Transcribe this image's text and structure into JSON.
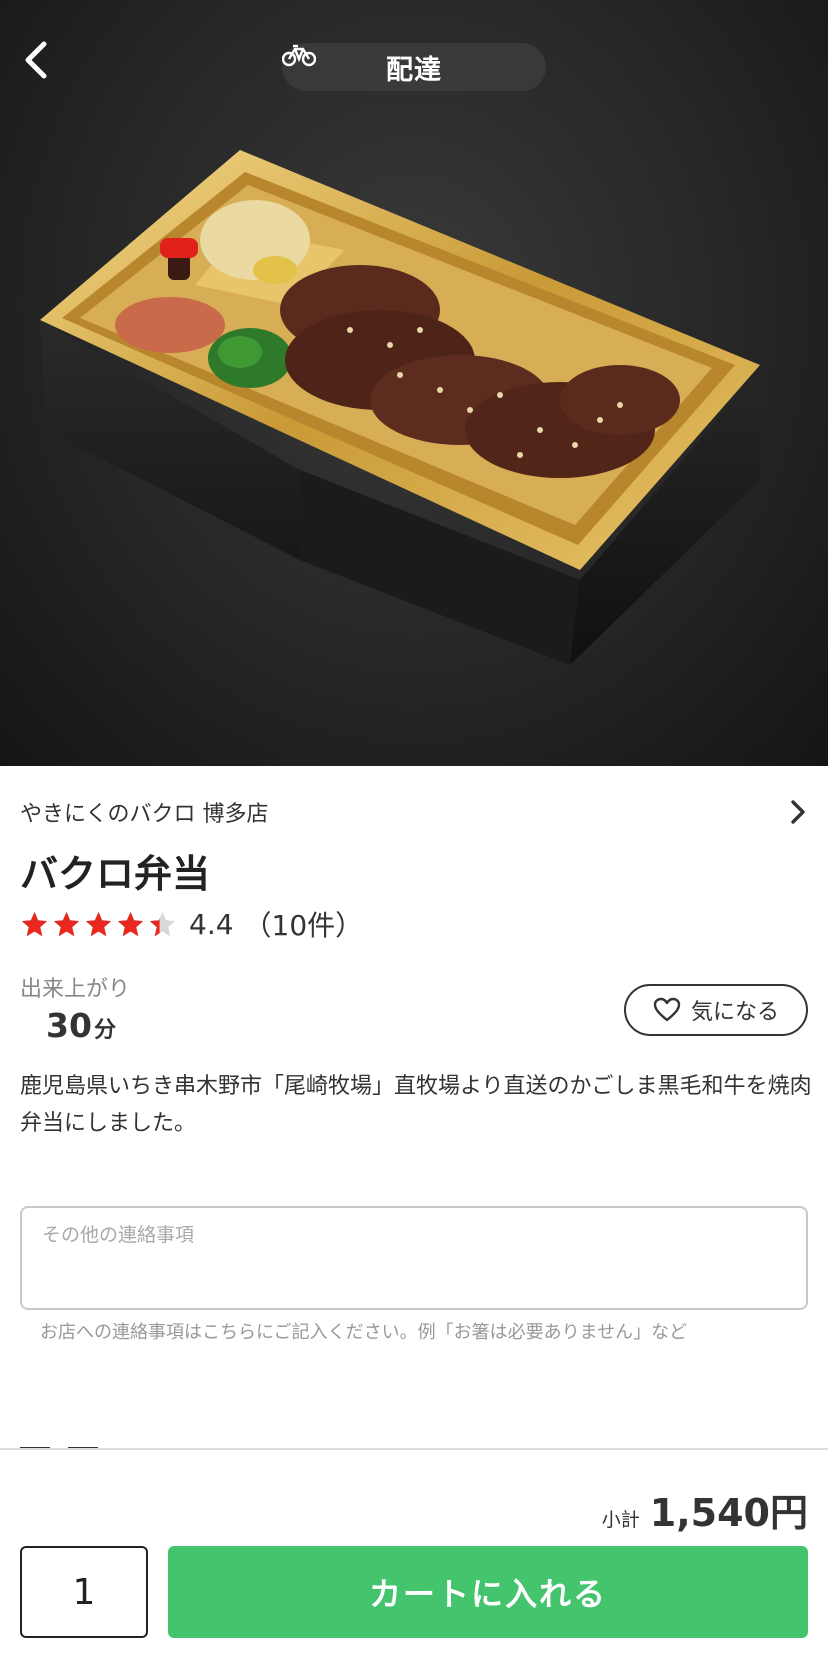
{
  "header": {
    "back_icon": "chevron-left-icon",
    "mode_icon": "bicycle-icon",
    "mode_label": "配達"
  },
  "product": {
    "store_name": "やきにくのバクロ 博多店",
    "store_link_icon": "chevron-right-icon",
    "title": "バクロ弁当",
    "rating": {
      "value": "4.4",
      "count": "（10件）",
      "stars": 4.4,
      "star_color": "#e8281e"
    },
    "ready": {
      "label": "出来上がり",
      "value": "30",
      "unit": "分"
    },
    "favorite": {
      "icon": "heart-icon",
      "label": "気になる"
    },
    "description": "鹿児島県いちき串木野市「尾崎牧場」直牧場より直送のかごしま黒毛和牛を焼肉弁当にしました。"
  },
  "note": {
    "placeholder": "その他の連絡事項",
    "hint": "お店への連絡事項はこちらにご記入ください。例「お箸は必要ありません」など"
  },
  "cart": {
    "subtotal_label": "小計",
    "subtotal_value": "1,540円",
    "quantity": "1",
    "add_label": "カートに入れる",
    "accent": "#44c46c"
  }
}
